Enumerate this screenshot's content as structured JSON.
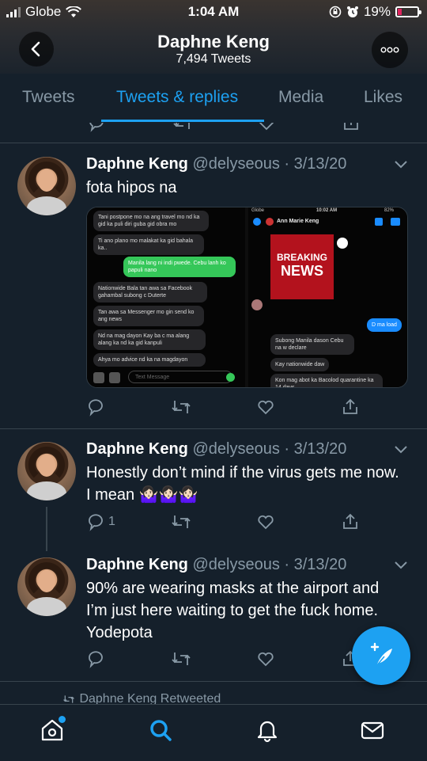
{
  "status_bar": {
    "carrier": "Globe",
    "time": "1:04 AM",
    "battery": "19%",
    "battery_level": 0.19
  },
  "header": {
    "name": "Daphne Keng",
    "tweet_count": "7,494 Tweets"
  },
  "tabs": [
    {
      "label": "Tweets"
    },
    {
      "label": "Tweets & replies"
    },
    {
      "label": "Media"
    },
    {
      "label": "Likes"
    }
  ],
  "tweets": [
    {
      "name": "Daphne Keng",
      "handle": "@delyseous",
      "date": "3/13/20",
      "text": "fota hipos na",
      "media": {
        "left": {
          "msgs": [
            "Tani postpone mo na ang travel mo nd ka gid ka puli diri guba gid obra mo",
            "Ti ano plano mo malakat ka gid bahala ka..",
            "Manila lang ni indi pwede. Cebu lanh ko papuli nano",
            "Nationwide Bala tan awa sa Facebook gahambal subong c Duterte",
            "Tan awa sa Messenger mo gin send ko ang news",
            "Nd na mag dayon Kay ba c ma alang alang ka nd ka gid kanpuli",
            "Ahya mo advice nd ka na magdayon"
          ],
          "input_placeholder": "Text Message"
        },
        "right": {
          "carrier": "Globe",
          "time": "10:02 AM",
          "battery": "82%",
          "contact": "Ann Marie Keng",
          "news_line1": "BREAKING",
          "news_line2": "NEWS",
          "msgs": [
            "D ma load",
            "Subong Manila dason Cebu na w declare",
            "Kay nationwide daw",
            "Kon mag abot ka Bacolod quarantine ka 14 days"
          ]
        }
      },
      "replies": "",
      "retweets": "",
      "likes": ""
    },
    {
      "name": "Daphne Keng",
      "handle": "@delyseous",
      "date": "3/13/20",
      "text": "Honestly don’t mind if the virus gets me now. I mean 🤷🏻‍♀️🤷🏻‍♀️🤷🏻‍♀️",
      "replies": "1",
      "retweets": "",
      "likes": ""
    },
    {
      "name": "Daphne Keng",
      "handle": "@delyseous",
      "date": "3/13/20",
      "text": "90% are wearing masks at the airport and I’m just here waiting to get the fuck home. Yodepota",
      "replies": "",
      "retweets": "",
      "likes": ""
    }
  ],
  "retweeted_label": "Daphne Keng Retweeted",
  "bottom_nav": [
    {
      "icon": "home-icon"
    },
    {
      "icon": "search-icon"
    },
    {
      "icon": "notifications-icon"
    },
    {
      "icon": "messages-icon"
    }
  ],
  "colors": {
    "accent": "#1da1f2",
    "background": "#15202b",
    "muted": "#8899a6",
    "divider": "#38444d"
  }
}
